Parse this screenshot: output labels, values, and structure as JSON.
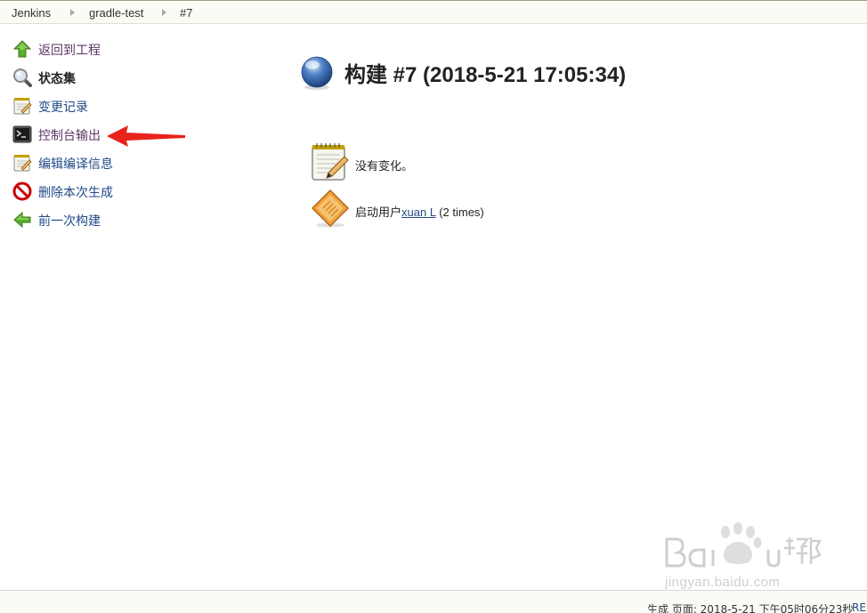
{
  "breadcrumb": {
    "items": [
      "Jenkins",
      "gradle-test",
      "#7"
    ]
  },
  "sidebar": {
    "items": [
      {
        "label": "返回到工程",
        "icon": "arrow-up-icon"
      },
      {
        "label": "状态集",
        "icon": "magnifier-icon"
      },
      {
        "label": "变更记录",
        "icon": "notepad-icon"
      },
      {
        "label": "控制台输出",
        "icon": "terminal-icon"
      },
      {
        "label": "编辑编译信息",
        "icon": "notepad-edit-icon"
      },
      {
        "label": "删除本次生成",
        "icon": "no-entry-icon"
      },
      {
        "label": "前一次构建",
        "icon": "arrow-left-icon"
      }
    ]
  },
  "main": {
    "title": "构建 #7 (2018-5-21 17:05:34)",
    "status_icon": "blue-ball-icon",
    "changes": {
      "text": "没有变化。",
      "icon": "notepad-icon"
    },
    "cause": {
      "prefix": "启动用户",
      "user": "xuan L",
      "suffix": " (2 times)",
      "icon": "user-cause-icon"
    }
  },
  "footer": {
    "generated": "生成 页面: 2018-5-21 下午05时06分23秒",
    "link": "RE"
  },
  "watermark": {
    "text": "jingyan.baidu.com"
  },
  "colors": {
    "link": "#204a87",
    "visited": "#5c3566",
    "annotation_arrow": "#e8231b",
    "bar_background": "#f9fbf4"
  }
}
